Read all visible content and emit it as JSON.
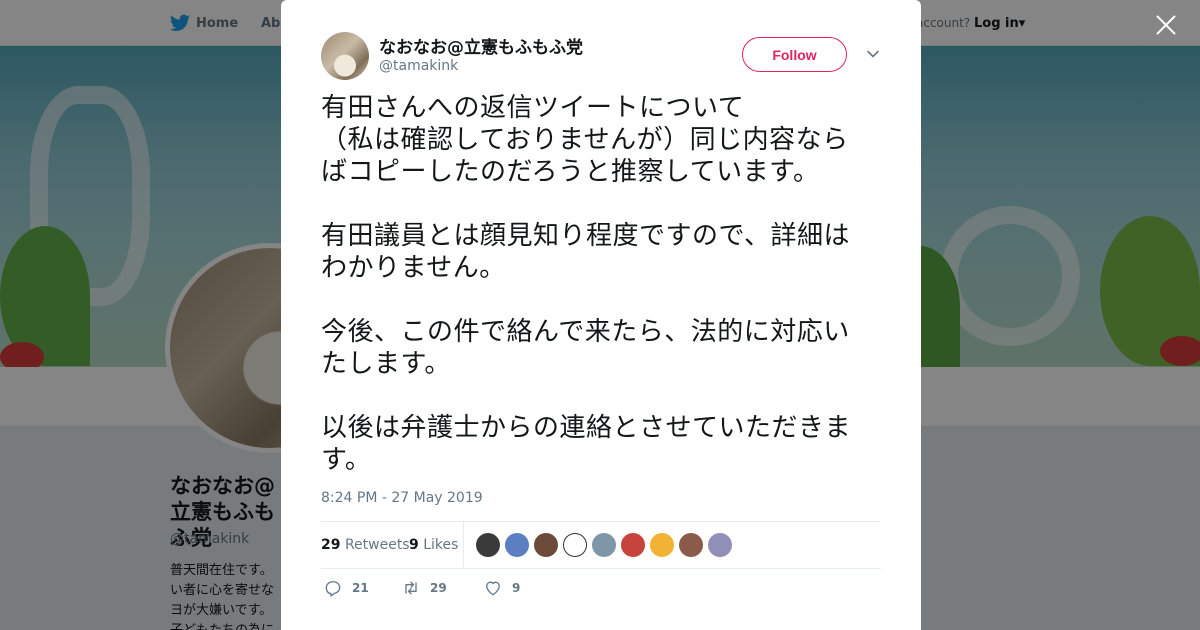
{
  "nav": {
    "home_label": "Home",
    "about_label": "Abo",
    "account_prompt": "account?",
    "login_label": "Log in"
  },
  "profile_background": {
    "name": "なおなお@立憲もふもふ党",
    "handle": "@tamakink",
    "bio": "普天間在住です。\nい者に心を寄せな\nヨが大嫌いです。\n子どもたちの為に"
  },
  "tweet": {
    "display_name": "なおなお@立憲もふもふ党",
    "handle": "@tamakink",
    "follow_label": "Follow",
    "text": "有田さんへの返信ツイートについて\n（私は確認しておりませんが）同じ内容なら\nばコピーしたのだろうと推察しています。\n\n有田議員とは顔見知り程度ですので、詳細は\nわかりません。\n\n今後、この件で絡んで来たら、法的に対応い\nたします。\n\n以後は弁護士からの連絡とさせていただきま\nす。",
    "timestamp": "8:24 PM - 27 May 2019",
    "retweets_count": "29",
    "retweets_label": "Retweets",
    "likes_count": "9",
    "likes_label": "Likes",
    "liker_colors": [
      "#3a3a3a",
      "#5b7fc2",
      "#6b4a3a",
      "#ffffff",
      "#7f95a8",
      "#c7443c",
      "#f2b233",
      "#8a5a4a",
      "#8f8fb8"
    ],
    "actions": {
      "replies": "21",
      "retweets": "29",
      "likes": "9"
    }
  },
  "colors": {
    "accent_follow": "#e0245e",
    "twitter_blue": "#1da1f2",
    "muted_text": "#657786"
  }
}
